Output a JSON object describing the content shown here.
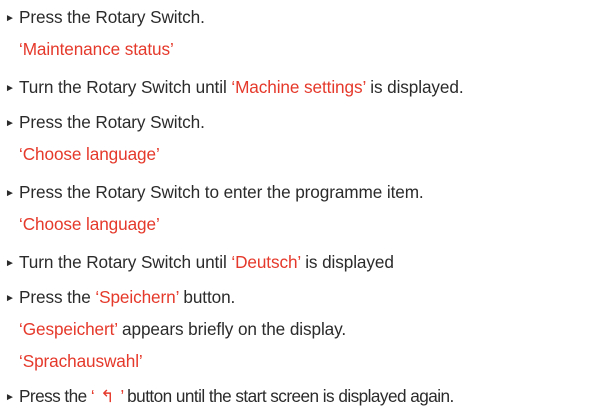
{
  "colors": {
    "text": "#2b2b2b",
    "highlight": "#e5392b"
  },
  "steps": [
    {
      "bullet": "►",
      "text": "Press the Rotary Switch."
    },
    {
      "result": "‘Maintenance status’"
    },
    {
      "bullet": "►",
      "pre": "Turn the Rotary Switch until ",
      "highlight": "‘Machine settings’",
      "post": " is displayed."
    },
    {
      "bullet": "►",
      "text": "Press the Rotary Switch."
    },
    {
      "result": "‘Choose language’"
    },
    {
      "bullet": "►",
      "text": "Press the Rotary Switch to enter the programme item."
    },
    {
      "result": "‘Choose language’"
    },
    {
      "bullet": "►",
      "pre": "Turn the Rotary Switch until ",
      "highlight": "‘Deutsch’",
      "post": " is displayed"
    },
    {
      "bullet": "►",
      "pre": "Press the ",
      "highlight": "‘Speichern’",
      "post": " button."
    },
    {
      "result_pre": "‘Gespeichert’",
      "result_post": " appears briefly on the display."
    },
    {
      "result": "‘Sprachauswahl’"
    },
    {
      "bullet": "►",
      "pre": "Press the ",
      "highlight_open": "‘ ",
      "icon": "return-icon",
      "icon_glyph": "↰",
      "highlight_close": " ’",
      "post": " button until the start screen is displayed again."
    }
  ]
}
